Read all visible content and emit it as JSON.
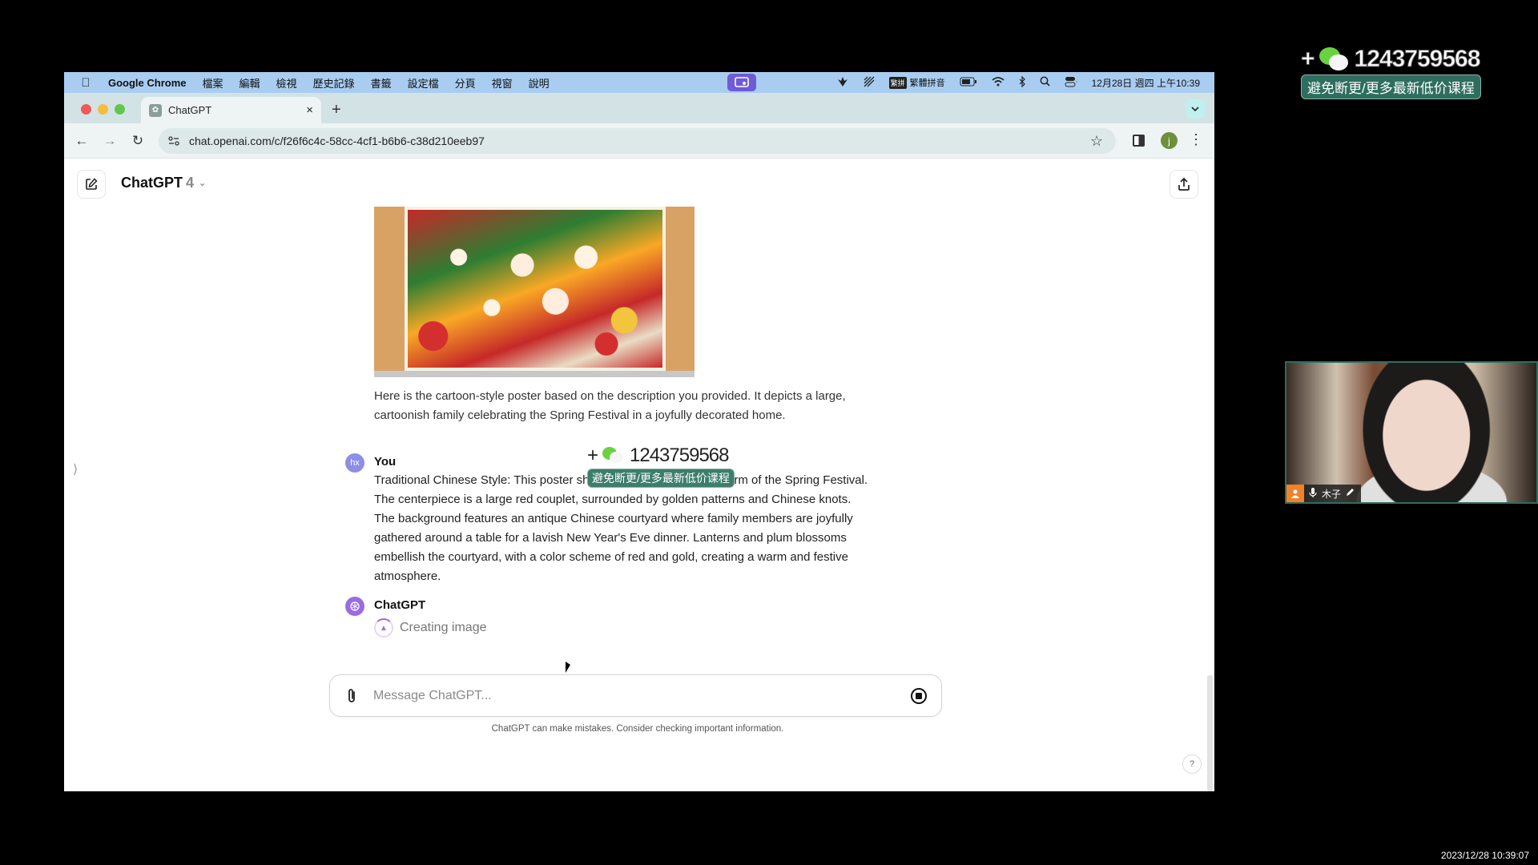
{
  "menubar": {
    "app_name": "Google Chrome",
    "items": [
      "檔案",
      "編輯",
      "檢視",
      "歷史記錄",
      "書籤",
      "設定檔",
      "分頁",
      "視窗",
      "說明"
    ],
    "input_method": "繁體拼音",
    "input_method_badge": "繁拼",
    "datetime": "12月28日 週四 上午10:39"
  },
  "browser": {
    "tab_title": "ChatGPT",
    "url": "chat.openai.com/c/f26f6c4c-58cc-4cf1-b6b6-c38d210eeb97",
    "profile_initial": "j"
  },
  "chat": {
    "model_name": "ChatGPT",
    "model_version": "4",
    "assistant_reply": "Here is the cartoon-style poster based on the description you provided. It depicts a large, cartoonish family celebrating the Spring Festival in a joyfully decorated home.",
    "user_avatar_initials": "hx",
    "user_name": "You",
    "user_message": "Traditional Chinese Style: This poster showcases the traditional charm of the Spring Festival. The centerpiece is a large red couplet, surrounded by golden patterns and Chinese knots. The background features an antique Chinese courtyard where family members are joyfully gathered around a table for a lavish New Year's Eve dinner. Lanterns and plum blossoms embellish the courtyard, with a color scheme of red and gold, creating a warm and festive atmosphere.",
    "assistant_name": "ChatGPT",
    "status": "Creating image",
    "composer_placeholder": "Message ChatGPT...",
    "disclaimer": "ChatGPT can make mistakes. Consider checking important information.",
    "help_label": "?"
  },
  "overlay": {
    "watermark_number": "1243759568",
    "watermark_badge": "避免断更/更多最新低价课程",
    "webcam_name": "木子",
    "recording_timestamp": "2023/12/28 10:39:07"
  },
  "colors": {
    "menubar_bg": "#a9cdf1",
    "tabstrip_bg": "#d3e3e5",
    "gpt_accent": "#9a6ce2",
    "user_avatar": "#8e8ee6",
    "watermark_badge": "#2f6e5e"
  }
}
